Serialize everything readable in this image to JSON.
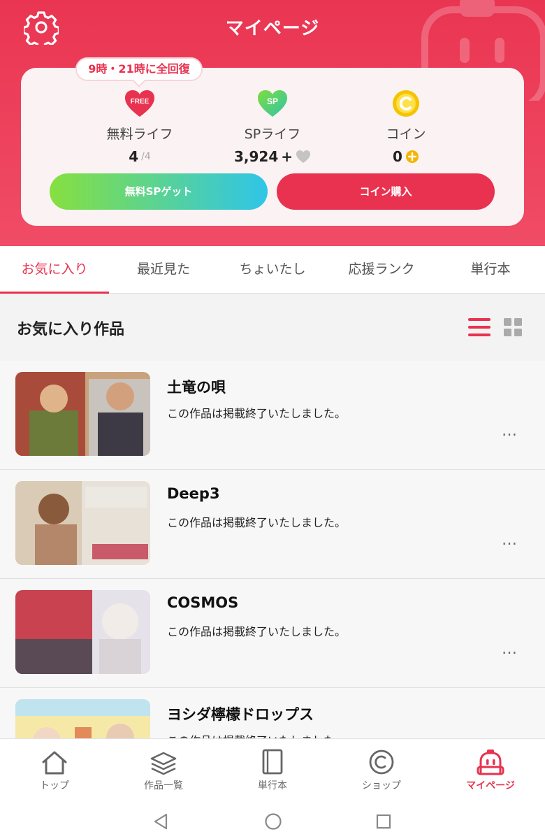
{
  "header": {
    "title": "マイページ",
    "recover_notice": "9時・21時に全回復"
  },
  "stats": {
    "free": {
      "icon_text": "FREE",
      "label": "無料ライフ",
      "value": "4",
      "max": "/4"
    },
    "sp": {
      "icon_text": "SP",
      "label": "SPライフ",
      "value": "3,924",
      "plus": "+"
    },
    "coin": {
      "label": "コイン",
      "value": "0"
    }
  },
  "buttons": {
    "get_sp": "無料SPゲット",
    "buy_coin": "コイン購入"
  },
  "tabs": [
    {
      "label": "お気に入り",
      "active": true
    },
    {
      "label": "最近見た",
      "active": false
    },
    {
      "label": "ちょいたし",
      "active": false
    },
    {
      "label": "応援ランク",
      "active": false
    },
    {
      "label": "単行本",
      "active": false
    }
  ],
  "section": {
    "title": "お気に入り作品"
  },
  "items": [
    {
      "title": "土竜の唄",
      "status": "この作品は掲載終了いたしました。",
      "more": "…"
    },
    {
      "title": "Deep3",
      "status": "この作品は掲載終了いたしました。",
      "more": "…"
    },
    {
      "title": "COSMOS",
      "status": "この作品は掲載終了いたしました。",
      "more": "…"
    },
    {
      "title": "ヨシダ檸檬ドロップス",
      "status": "この作品は掲載終了いたしました。",
      "more": "…"
    }
  ],
  "bottom_nav": [
    {
      "label": "トップ",
      "icon": "home-icon",
      "active": false
    },
    {
      "label": "作品一覧",
      "icon": "books-stack-icon",
      "active": false
    },
    {
      "label": "単行本",
      "icon": "book-icon",
      "active": false
    },
    {
      "label": "ショップ",
      "icon": "copyright-coin-icon",
      "active": false
    },
    {
      "label": "マイページ",
      "icon": "mascot-icon",
      "active": true
    }
  ],
  "colors": {
    "accent": "#e8324f",
    "header_bg": "#ea3552",
    "sp_green": "#6ecf3c",
    "coin_yellow": "#f5c400"
  }
}
